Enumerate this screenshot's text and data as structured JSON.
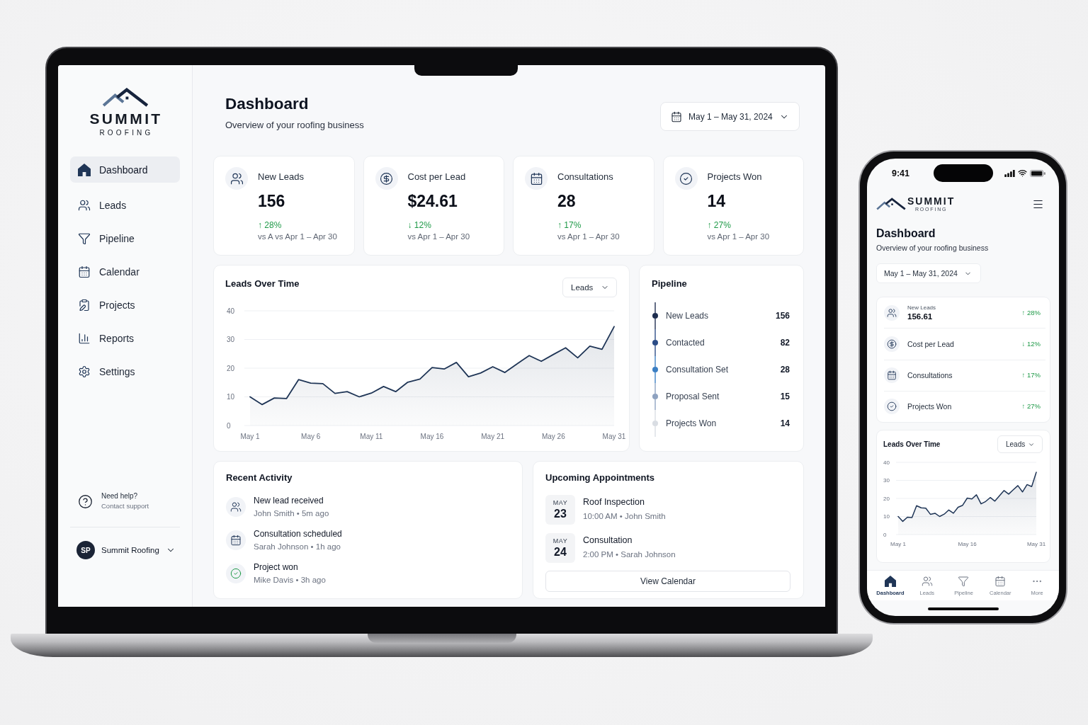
{
  "laptop": {
    "sidebar": {
      "brand": {
        "name": "SUMMIT",
        "tagline": "ROOFING"
      },
      "nav": [
        {
          "label": "Dashboard",
          "selected": true
        },
        {
          "label": "Leads",
          "selected": false
        },
        {
          "label": "Pipeline",
          "selected": false
        },
        {
          "label": "Calendar",
          "selected": false
        },
        {
          "label": "Projects",
          "selected": false
        },
        {
          "label": "Reports",
          "selected": false
        },
        {
          "label": "Settings",
          "selected": false
        }
      ],
      "help": {
        "title": "Need help?",
        "link": "Contact support"
      },
      "account": {
        "initials": "SP",
        "name": "Summit Roofing"
      }
    },
    "header": {
      "title": "Dashboard",
      "subtitle": "Overview of your roofing business",
      "date_range": "May 1 – May 31, 2024"
    },
    "stats": [
      {
        "label": "New Leads",
        "value": "156",
        "change": "↑ 28%",
        "comparison": "vs A vs Apr 1 – Apr 30"
      },
      {
        "label": "Cost per Lead",
        "value": "$24.61",
        "change": "↓ 12%",
        "comparison": "vs Apr 1 – Apr 30"
      },
      {
        "label": "Consultations",
        "value": "28",
        "change": "↑ 17%",
        "comparison": "vs Apr 1 – Apr 30"
      },
      {
        "label": "Projects Won",
        "value": "14",
        "change": "↑ 27%",
        "comparison": "vs Apr 1 – Apr 30"
      }
    ],
    "leads_chart": {
      "title": "Leads Over Time",
      "chart_data": {
        "type": "area",
        "grid": true,
        "categories": [
          "May 1",
          null,
          null,
          null,
          null,
          "May 6",
          null,
          null,
          null,
          null,
          "May 11",
          null,
          null,
          null,
          null,
          "May 16",
          null,
          null,
          null,
          null,
          "May 21",
          null,
          null,
          null,
          null,
          "May 26",
          null,
          null,
          null,
          null,
          "May 31"
        ],
        "series": [
          {
            "name": "Leads",
            "color": "#1f3556",
            "values": [
              10,
              7.3,
              9.6,
              9.4,
              16,
              14.8,
              14.6,
              11.2,
              11.8,
              10,
              11.3,
              13.6,
              11.8,
              15.1,
              16.2,
              20.2,
              19.7,
              22,
              17,
              18.3,
              20.5,
              18.5,
              21.5,
              24.4,
              22.4,
              24.8,
              27.1,
              23.6,
              27.7,
              26.6,
              34.5
            ]
          }
        ],
        "ylim": [
          0,
          40
        ],
        "yticks": [
          0,
          10,
          20,
          30,
          40
        ]
      }
    },
    "pipeline": {
      "title": "Pipeline",
      "stages": [
        {
          "label": "New Leads",
          "count": "156",
          "color": "#1e2d4f"
        },
        {
          "label": "Contacted",
          "count": "82",
          "color": "#2b4c86"
        },
        {
          "label": "Consultation Set",
          "count": "28",
          "color": "#3b7fc4"
        },
        {
          "label": "Proposal Sent",
          "count": "15",
          "color": "#8ea2c0"
        },
        {
          "label": "Projects Won",
          "count": "14",
          "color": "#d9dde3"
        }
      ]
    },
    "recent_activity": {
      "title": "Recent Activity",
      "items": [
        {
          "title": "New lead received",
          "meta": "John Smith • 5m ago"
        },
        {
          "title": "Consultation scheduled",
          "meta": "Sarah Johnson • 1h ago"
        },
        {
          "title": "Project won",
          "meta": "Mike Davis • 3h ago"
        }
      ]
    },
    "appointments": {
      "title": "Upcoming Appointments",
      "items": [
        {
          "month": "MAY",
          "day": "23",
          "title": "Roof Inspection",
          "meta": "10:00 AM • John Smith"
        },
        {
          "month": "MAY",
          "day": "24",
          "title": "Consultation",
          "meta": "2:00 PM • Sarah Johnson"
        }
      ],
      "button": "View Calendar"
    }
  },
  "phone": {
    "status_bar": {
      "time": "9:41"
    },
    "brand": {
      "name": "SUMMIT",
      "tagline": "ROOFING"
    },
    "header": {
      "title": "Dashboard",
      "subtitle": "Overview of your roofing business",
      "date_range": "May 1 – May 31, 2024"
    },
    "stats": [
      {
        "label": "New Leads",
        "value": "156.61",
        "change": "↑ 28%"
      },
      {
        "label": "Cost per Lead",
        "change": "↓ 12%"
      },
      {
        "label": "Consultations",
        "change": "↑ 17%"
      },
      {
        "label": "Projects Won",
        "change": "↑ 27%"
      }
    ],
    "leads_chart": {
      "title": "Leads Over Time",
      "chart_data": {
        "type": "area",
        "grid": true,
        "categories": [
          "May 1",
          null,
          null,
          null,
          null,
          null,
          null,
          null,
          null,
          null,
          null,
          null,
          null,
          null,
          null,
          "May 16",
          null,
          null,
          null,
          null,
          null,
          null,
          null,
          null,
          null,
          null,
          null,
          null,
          null,
          null,
          "May 31"
        ],
        "series": [
          {
            "name": "Leads",
            "color": "#1f3556",
            "values": [
              10,
              7.3,
              9.6,
              9.4,
              16,
              14.8,
              14.6,
              11.2,
              11.8,
              10,
              11.3,
              13.6,
              11.8,
              15.1,
              16.2,
              20.2,
              19.7,
              22,
              17,
              18.3,
              20.5,
              18.5,
              21.5,
              24.4,
              22.4,
              24.8,
              27.1,
              23.6,
              27.7,
              26.6,
              34.5
            ]
          }
        ],
        "ylim": [
          0,
          40
        ],
        "yticks": [
          0,
          10,
          20,
          30,
          40
        ]
      }
    },
    "tab_bar": [
      {
        "label": "Dashboard",
        "selected": true
      },
      {
        "label": "Leads",
        "selected": false
      },
      {
        "label": "Pipeline",
        "selected": false
      },
      {
        "label": "Calendar",
        "selected": false
      },
      {
        "label": "More",
        "selected": false
      }
    ]
  }
}
